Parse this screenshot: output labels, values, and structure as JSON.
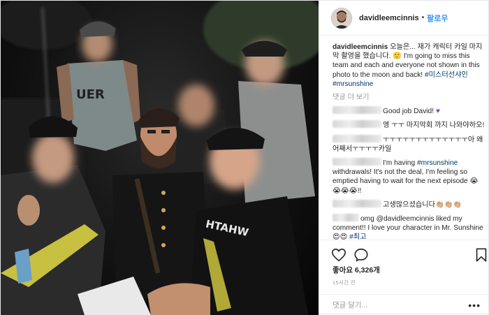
{
  "post": {
    "username": "davidleemcinnis",
    "follow_separator": "•",
    "follow_label": "팔로우",
    "caption_user": "davidleemcinnis",
    "caption_text": " 오늘은... 재가 캐릭터 카일 마지막 촬영을 했습니다. 🙂 I'm going to miss this team and each and everyone not shown in this photo to the moon and back! ",
    "caption_tags": [
      "#미스터선샤인",
      "#mrsunshine"
    ],
    "view_more_label": "댓글 더 보기",
    "comments": [
      {
        "text": "Good job David! ",
        "emoji": "♥"
      },
      {
        "text": "엥 ㅜㅜ 마지막회 까지 나와야하오!"
      },
      {
        "text": "ㅜㅜㅜㅜㅜㅜㅜㅜㅜㅜㅜㅜㅜ아 왜 어째서ㅜㅜㅜㅜ카일"
      },
      {
        "pre": "I'm having ",
        "tag": "#mrsunshine",
        "post": " withdrawals! It's not the deal, I'm feeling so emptied having to wait for the next episode 😭😭😭😭!!"
      },
      {
        "text": "고생많으셨습니다👏🏼👏🏼👏🏼"
      },
      {
        "pre": "omg @davidleemcinnis liked my comment!! I love your character in Mr. Sunshine 😍😍 ",
        "tag": "#최고"
      }
    ],
    "likes_label": "좋아요 6,326개",
    "time_label": "15시간 전",
    "add_comment_placeholder": "댓글 달기...",
    "more_options": "•••"
  },
  "icons": {
    "like": "heart-outline-icon",
    "comment": "speech-bubble-icon",
    "bookmark": "bookmark-icon"
  },
  "colors": {
    "link": "#003569",
    "follow": "#3897f0",
    "muted": "#999999"
  }
}
